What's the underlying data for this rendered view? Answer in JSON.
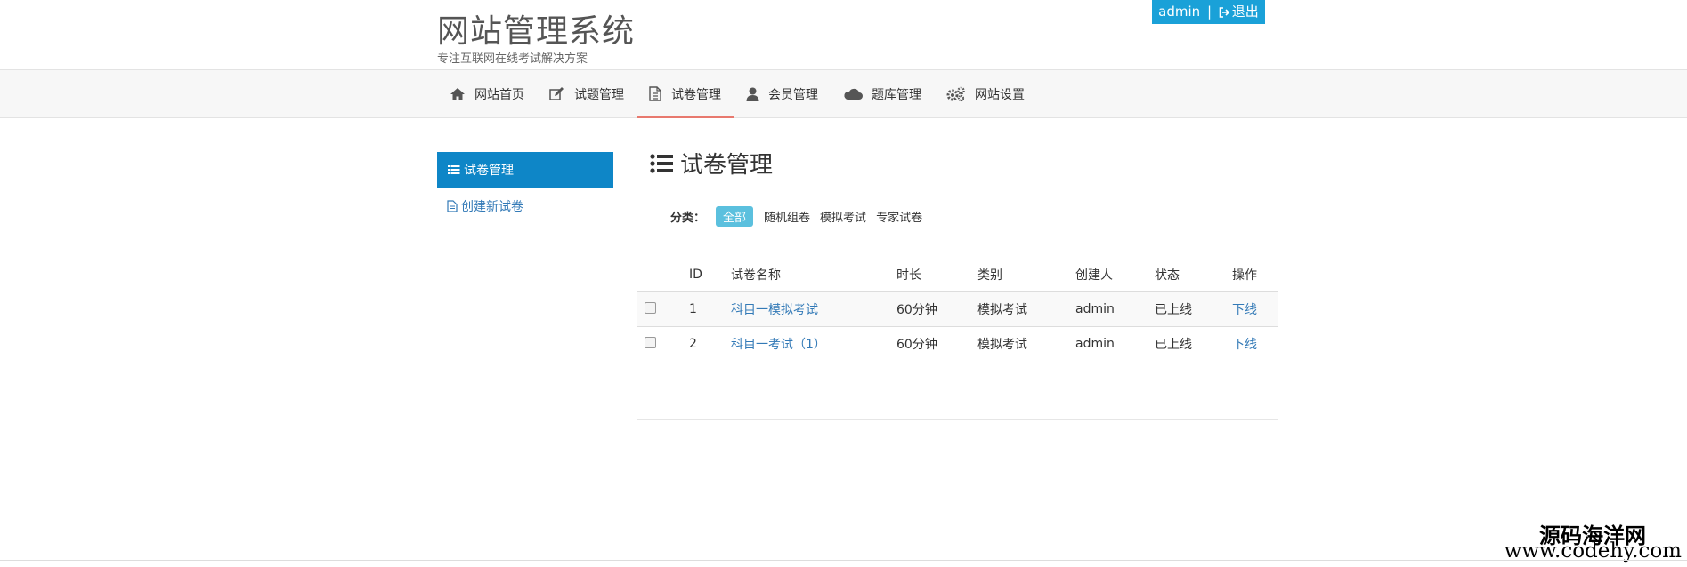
{
  "header": {
    "title": "网站管理系统",
    "subtitle": "专注互联网在线考试解决方案",
    "user": "admin",
    "separator": "|",
    "logout": "退出"
  },
  "nav": {
    "items": [
      {
        "label": "网站首页",
        "icon": "home-icon"
      },
      {
        "label": "试题管理",
        "icon": "edit-icon"
      },
      {
        "label": "试卷管理",
        "icon": "document-icon",
        "active": true
      },
      {
        "label": "会员管理",
        "icon": "user-icon"
      },
      {
        "label": "题库管理",
        "icon": "cloud-icon"
      },
      {
        "label": "网站设置",
        "icon": "gears-icon"
      }
    ],
    "active_color": "#e8796e"
  },
  "sidebar": {
    "active_label": "试卷管理",
    "create_label": "创建新试卷",
    "active_bg": "#0e86c7"
  },
  "main": {
    "heading": "试卷管理",
    "filter": {
      "label": "分类：",
      "options": [
        "全部",
        "随机组卷",
        "模拟考试",
        "专家试卷"
      ],
      "selected": "全部"
    },
    "table": {
      "columns": [
        "ID",
        "试卷名称",
        "时长",
        "类别",
        "创建人",
        "状态",
        "操作"
      ],
      "rows": [
        {
          "id": "1",
          "name": "科目一模拟考试",
          "duration": "60分钟",
          "category": "模拟考试",
          "creator": "admin",
          "status": "已上线",
          "action": "下线"
        },
        {
          "id": "2",
          "name": "科目一考试（1）",
          "duration": "60分钟",
          "category": "模拟考试",
          "creator": "admin",
          "status": "已上线",
          "action": "下线"
        }
      ]
    }
  },
  "watermark": {
    "line1": "源码海洋网",
    "line2": "www.codehy.com"
  }
}
